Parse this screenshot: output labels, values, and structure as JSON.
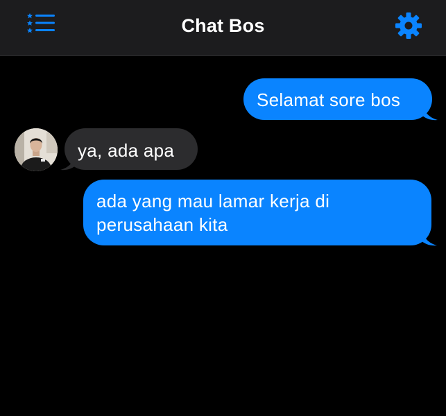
{
  "header": {
    "title": "Chat Bos",
    "menu_icon": "list-menu-icon",
    "settings_icon": "gear-icon"
  },
  "colors": {
    "accent": "#0a84ff",
    "header_bg": "#1c1c1e",
    "incoming_bubble": "#2c2c2e",
    "background": "#000000"
  },
  "messages": [
    {
      "direction": "outgoing",
      "text": "Selamat sore bos"
    },
    {
      "direction": "incoming",
      "text": "ya, ada apa"
    },
    {
      "direction": "outgoing",
      "text": "ada yang mau lamar kerja di perusahaan kita"
    }
  ]
}
